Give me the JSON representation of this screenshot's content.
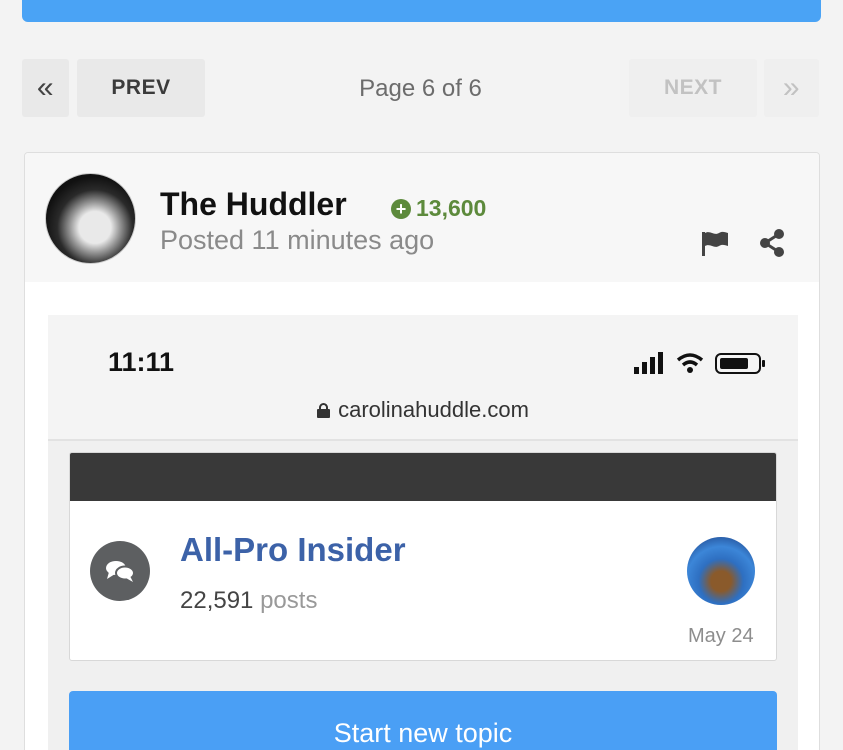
{
  "pagination": {
    "first_glyph": "«",
    "prev_label": "PREV",
    "page_label": "Page 6 of 6",
    "next_label": "NEXT",
    "last_glyph": "»"
  },
  "post": {
    "author": "The Huddler",
    "reputation": "13,600",
    "reputation_icon": "plus-circle-icon",
    "posted": "Posted 11 minutes ago",
    "actions": [
      "flag-icon",
      "share-icon"
    ]
  },
  "embedded_screenshot": {
    "time": "11:11",
    "url": "carolinahuddle.com",
    "forum": {
      "title": "All-Pro Insider",
      "post_count": "22,591",
      "post_label": "posts",
      "last_date": "May 24"
    },
    "start_button": "Start new topic"
  },
  "colors": {
    "accent_blue": "#4aa3f5",
    "reputation_green": "#5d8a3c",
    "forum_link": "#3c62a8"
  }
}
